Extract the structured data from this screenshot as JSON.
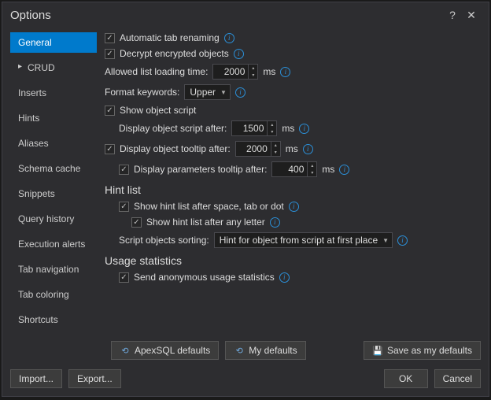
{
  "window": {
    "title": "Options"
  },
  "sidebar": {
    "items": [
      {
        "label": "General"
      },
      {
        "label": "CRUD"
      },
      {
        "label": "Inserts"
      },
      {
        "label": "Hints"
      },
      {
        "label": "Aliases"
      },
      {
        "label": "Schema cache"
      },
      {
        "label": "Snippets"
      },
      {
        "label": "Query history"
      },
      {
        "label": "Execution alerts"
      },
      {
        "label": "Tab navigation"
      },
      {
        "label": "Tab coloring"
      },
      {
        "label": "Shortcuts"
      }
    ]
  },
  "general": {
    "auto_tab_renaming": "Automatic tab renaming",
    "decrypt_objects": "Decrypt encrypted objects",
    "allowed_list_label": "Allowed list loading time:",
    "allowed_list_value": "2000",
    "format_keywords_label": "Format keywords:",
    "format_keywords_value": "Upper",
    "show_object_script": "Show object script",
    "display_script_after_label": "Display object script after:",
    "display_script_after_value": "1500",
    "display_tooltip_after_label": "Display object tooltip after:",
    "display_tooltip_after_value": "2000",
    "display_params_tooltip_label": "Display parameters tooltip after:",
    "display_params_tooltip_value": "400",
    "ms": "ms",
    "hintlist_title": "Hint list",
    "show_hint_space": "Show hint list after space, tab or dot",
    "show_hint_letter": "Show hint list after any letter",
    "script_sorting_label": "Script objects sorting:",
    "script_sorting_value": "Hint for object from script at first place",
    "usage_title": "Usage statistics",
    "send_anon": "Send anonymous usage statistics"
  },
  "footer": {
    "apex_defaults": "ApexSQL defaults",
    "my_defaults": "My defaults",
    "save_defaults": "Save as my defaults",
    "import": "Import...",
    "export": "Export...",
    "ok": "OK",
    "cancel": "Cancel"
  }
}
